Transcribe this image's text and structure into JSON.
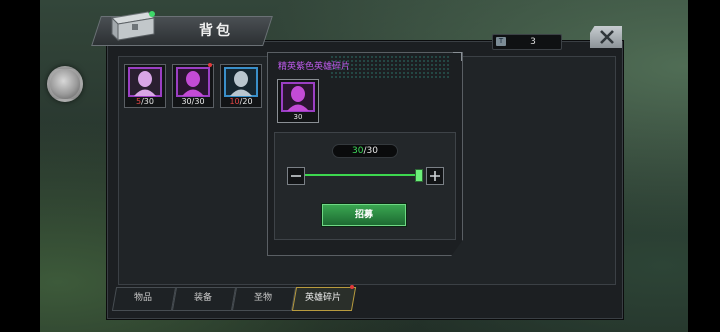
{
  "window": {
    "title": "背包"
  },
  "currency": {
    "icon": "ticket-icon",
    "value": "3"
  },
  "inventory": {
    "items": [
      {
        "count_current": "5",
        "count_max": "/30",
        "frame_color": "#9b3fc4",
        "card_color": "#d8a6e6"
      },
      {
        "count_current": "30",
        "count_max": "/30",
        "frame_color": "#9b3fc4",
        "card_color": "#c34bd6",
        "has_badge": true
      },
      {
        "count_current": "10",
        "count_max": "/20",
        "frame_color": "#3a8fc9",
        "card_color": "#b9c6cf"
      }
    ]
  },
  "detail_popup": {
    "title": "精英紫色英雄碎片",
    "item_count": "30",
    "quantity_current": "30",
    "quantity_max": "/30",
    "slider_fraction": 1.0,
    "minus_icon": "minus-icon",
    "plus_icon": "plus-icon",
    "recruit_label": "招募"
  },
  "tabs": [
    {
      "label": "物品",
      "active": false
    },
    {
      "label": "装备",
      "active": false
    },
    {
      "label": "圣物",
      "active": false
    },
    {
      "label": "英雄碎片",
      "active": true,
      "has_badge": true
    }
  ],
  "colors": {
    "accent_green": "#3dd84f",
    "rarity_purple": "#c15cf0",
    "badge_red": "#e23a3a"
  }
}
